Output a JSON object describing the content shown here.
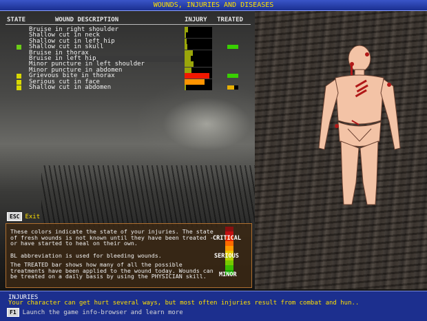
{
  "window": {
    "title": "WOUNDS, INJURIES AND DISEASES"
  },
  "columns": {
    "state": "STATE",
    "description": "WOUND DESCRIPTION",
    "injury": "INJURY",
    "treated": "TREATED"
  },
  "colors": {
    "state_green": "#6ccd18",
    "state_yellow": "#d8d800",
    "injury_green": "#9aa60a",
    "injury_yellow": "#d8b800",
    "injury_red": "#f01800",
    "injury_orange": "#ff9400",
    "treated_green": "#38d000",
    "treated_yellow": "#e8b000"
  },
  "wounds": [
    {
      "name": "Bruise in right shoulder",
      "state": "",
      "injury": 0.12,
      "injury_color": "#9aa60a",
      "treated": 0
    },
    {
      "name": "Shallow cut in neck",
      "state": "",
      "injury": 0.05,
      "injury_color": "#9aa60a",
      "treated": 0
    },
    {
      "name": "Shallow cut in left hip",
      "state": "",
      "injury": 0.08,
      "injury_color": "#9aa60a",
      "treated": 0
    },
    {
      "name": "Shallow cut in skull",
      "state": "green",
      "injury": 0.1,
      "injury_color": "#9aa60a",
      "treated": 1
    },
    {
      "name": "Bruise in thorax",
      "state": "",
      "injury": 0.3,
      "injury_color": "#9aa60a",
      "treated": 0
    },
    {
      "name": "Bruise in left hip",
      "state": "",
      "injury": 0.22,
      "injury_color": "#9aa60a",
      "treated": 0,
      "selected": true
    },
    {
      "name": "Minor puncture in left shoulder",
      "state": "",
      "injury": 0.33,
      "injury_color": "#9aa60a",
      "treated": 0
    },
    {
      "name": "Minor puncture in abdomen",
      "state": "",
      "injury": 0.25,
      "injury_color": "#9aa60a",
      "treated": 0
    },
    {
      "name": "Grievous bite in thorax",
      "state": "yellow",
      "injury": 0.9,
      "injury_color": "#f01800",
      "treated": 1
    },
    {
      "name": "Serious cut in face",
      "state": "yellow",
      "injury": 0.72,
      "injury_color": "#ff9400",
      "treated": 0
    },
    {
      "name": "Shallow cut in abdomen",
      "state": "yellow",
      "injury": 0.05,
      "injury_color": "#9aa60a",
      "treated": 0.6
    }
  ],
  "esc": {
    "key": "ESC",
    "label": "Exit"
  },
  "info": {
    "p1": "These colors indicate the state of your injuries. The state of fresh wounds is not known until they have been treated - or have started to heal on their own.",
    "p2": "BL abbreviation is used for bleeding wounds.",
    "p3": "The TREATED bar shows how many of all the possible treatments have been applied to the wound today. Wounds can be treated on a daily basis by using the PHYSICIAN skill.",
    "critical": "CRITICAL",
    "serious": "SERIOUS",
    "minor": "MINOR",
    "legend_colors": [
      "#8a1010",
      "#c01010",
      "#e02a00",
      "#ff6a00",
      "#ff9a00",
      "#e8c800",
      "#b8d000",
      "#78c800",
      "#3cbc00",
      "#18a800"
    ]
  },
  "bottom": {
    "title": "INJURIES",
    "text": "Your character can get hurt several ways, but most often injuries result from combat and hun..",
    "f1_key": "F1",
    "f1_text": "Launch the game info-browser and learn more"
  }
}
